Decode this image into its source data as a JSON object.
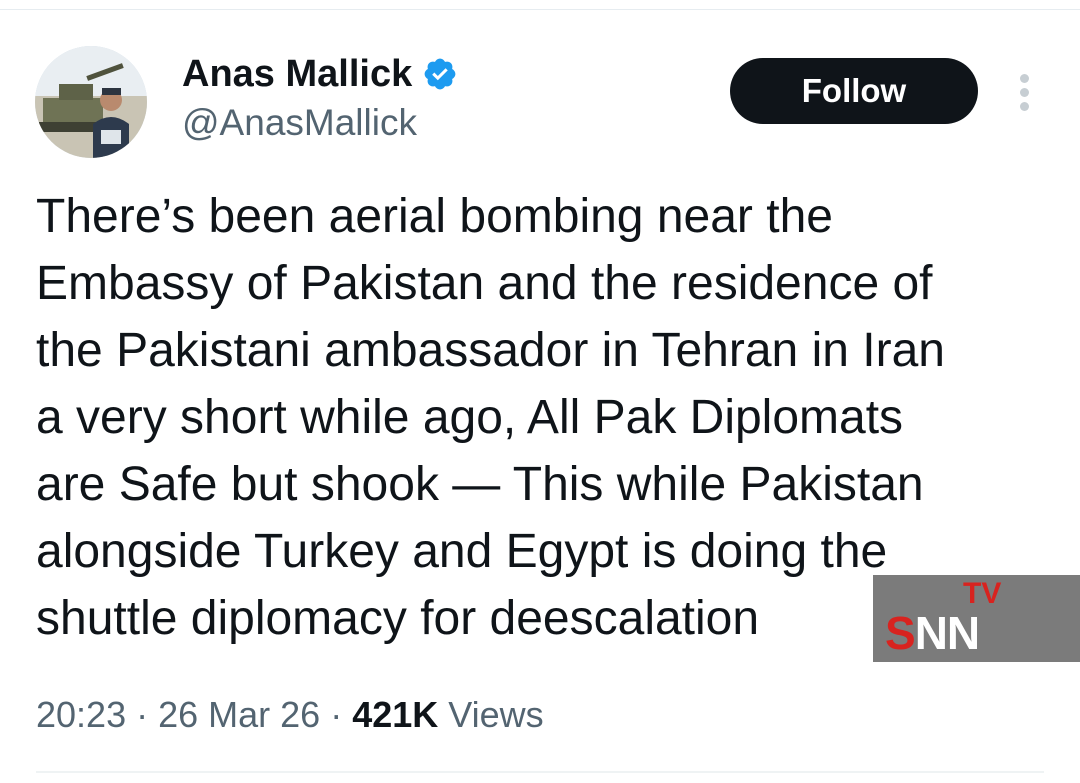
{
  "author": {
    "name": "Anas Mallick",
    "handle": "@AnasMallick",
    "verified": true,
    "avatar_icon": "profile-photo"
  },
  "actions": {
    "follow_label": "Follow",
    "more_icon": "more-vertical-icon"
  },
  "tweet": {
    "text": "There’s been aerial bombing near the\nEmbassy of Pakistan and the residence of\nthe Pakistani ambassador in Tehran in Iran\na very short while ago, All Pak Diplomats\nare Safe but shook — This while Pakistan\nalongside Turkey and Egypt is doing the\nshuttle diplomacy for deescalation"
  },
  "meta": {
    "time": "20:23",
    "separator": " · ",
    "date": "26 Mar 26",
    "views_count": "421K",
    "views_label": " Views"
  },
  "watermark": {
    "tv": "TV",
    "s": "S",
    "nn": "NN"
  },
  "colors": {
    "text": "#0f1419",
    "secondary": "#536471",
    "verified": "#1d9bf0",
    "button": "#0f1419",
    "watermark_red": "#d8231f"
  }
}
